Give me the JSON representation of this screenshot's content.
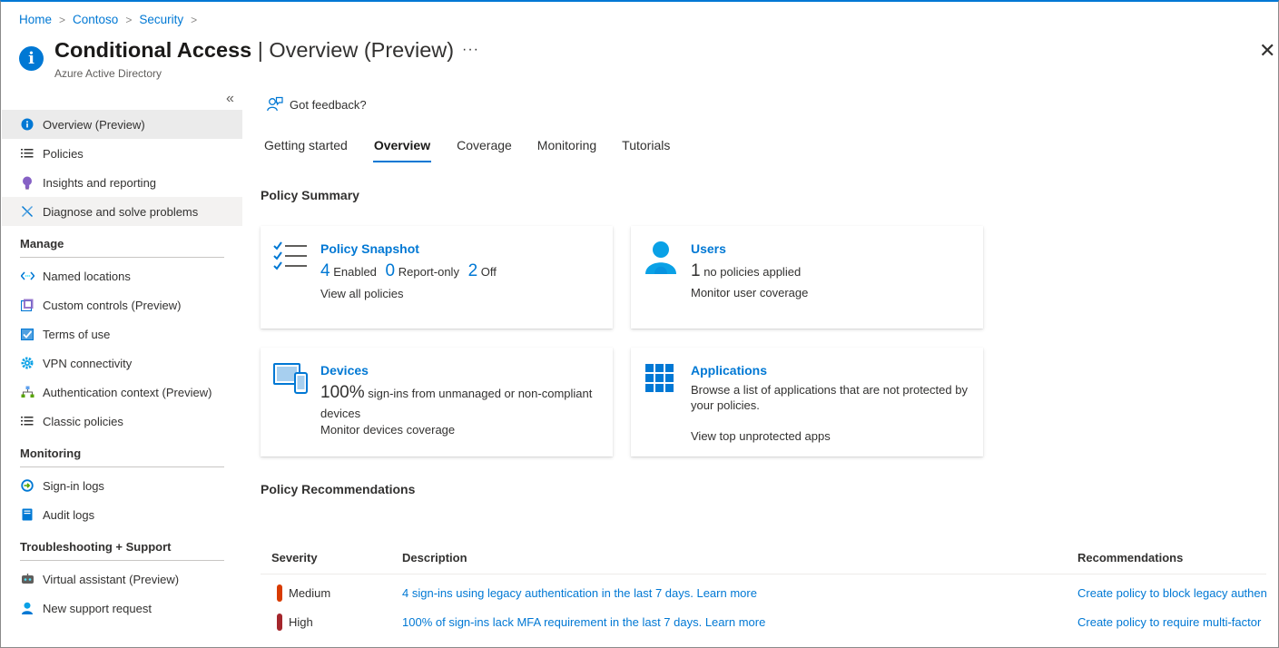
{
  "breadcrumb": [
    "Home",
    "Contoso",
    "Security"
  ],
  "header": {
    "title_main": "Conditional Access",
    "title_rest": "Overview (Preview)",
    "subtitle": "Azure Active Directory",
    "more": "···",
    "close": "✕"
  },
  "sidebar": {
    "collapse": "«",
    "items": [
      {
        "label": "Overview (Preview)",
        "icon": "info-icon"
      },
      {
        "label": "Policies",
        "icon": "list-icon"
      },
      {
        "label": "Insights and reporting",
        "icon": "lightbulb-icon"
      },
      {
        "label": "Diagnose and solve problems",
        "icon": "wrench-icon"
      }
    ],
    "sections": [
      {
        "heading": "Manage",
        "items": [
          {
            "label": "Named locations",
            "icon": "code-icon"
          },
          {
            "label": "Custom controls (Preview)",
            "icon": "custom-control-icon"
          },
          {
            "label": "Terms of use",
            "icon": "checkmark-doc-icon"
          },
          {
            "label": "VPN connectivity",
            "icon": "gear-icon"
          },
          {
            "label": "Authentication context (Preview)",
            "icon": "hierarchy-icon"
          },
          {
            "label": "Classic policies",
            "icon": "list-icon"
          }
        ]
      },
      {
        "heading": "Monitoring",
        "items": [
          {
            "label": "Sign-in logs",
            "icon": "signin-icon"
          },
          {
            "label": "Audit logs",
            "icon": "book-icon"
          }
        ]
      },
      {
        "heading": "Troubleshooting + Support",
        "items": [
          {
            "label": "Virtual assistant (Preview)",
            "icon": "assistant-icon"
          },
          {
            "label": "New support request",
            "icon": "person-icon"
          }
        ]
      }
    ]
  },
  "main": {
    "feedback": "Got feedback?",
    "tabs": [
      "Getting started",
      "Overview",
      "Coverage",
      "Monitoring",
      "Tutorials"
    ],
    "selected_tab": "Overview",
    "policy_summary": "Policy Summary",
    "cards": {
      "snapshot": {
        "title": "Policy Snapshot",
        "enabled_count": "4",
        "enabled_label": "Enabled",
        "report_count": "0",
        "report_label": "Report-only",
        "off_count": "2",
        "off_label": "Off",
        "link": "View all policies"
      },
      "users": {
        "title": "Users",
        "count": "1",
        "text": "no policies applied",
        "link": "Monitor user coverage"
      },
      "devices": {
        "title": "Devices",
        "percent": "100%",
        "text": "sign-ins from unmanaged or non-compliant",
        "text2": "devices",
        "link": "Monitor devices coverage"
      },
      "applications": {
        "title": "Applications",
        "text": "Browse a list of applications that are not protected by",
        "text2": "your policies.",
        "link": "View top unprotected apps"
      }
    },
    "policy_recommendations": "Policy Recommendations",
    "table": {
      "headers": [
        "Severity",
        "Description",
        "Recommendations"
      ],
      "rows": [
        {
          "severity": "Medium",
          "color": "#d83b01",
          "description": "4 sign-ins using legacy authentication in the last 7 days. Learn more",
          "recommendation": "Create policy to block legacy authen"
        },
        {
          "severity": "High",
          "color": "#a4262c",
          "description": "100% of sign-ins lack MFA requirement in the last 7 days. Learn more",
          "recommendation": "Create policy to require multi-factor"
        }
      ]
    }
  },
  "colors": {
    "accent": "#0078d4",
    "medium": "#d83b01",
    "high": "#a4262c"
  }
}
